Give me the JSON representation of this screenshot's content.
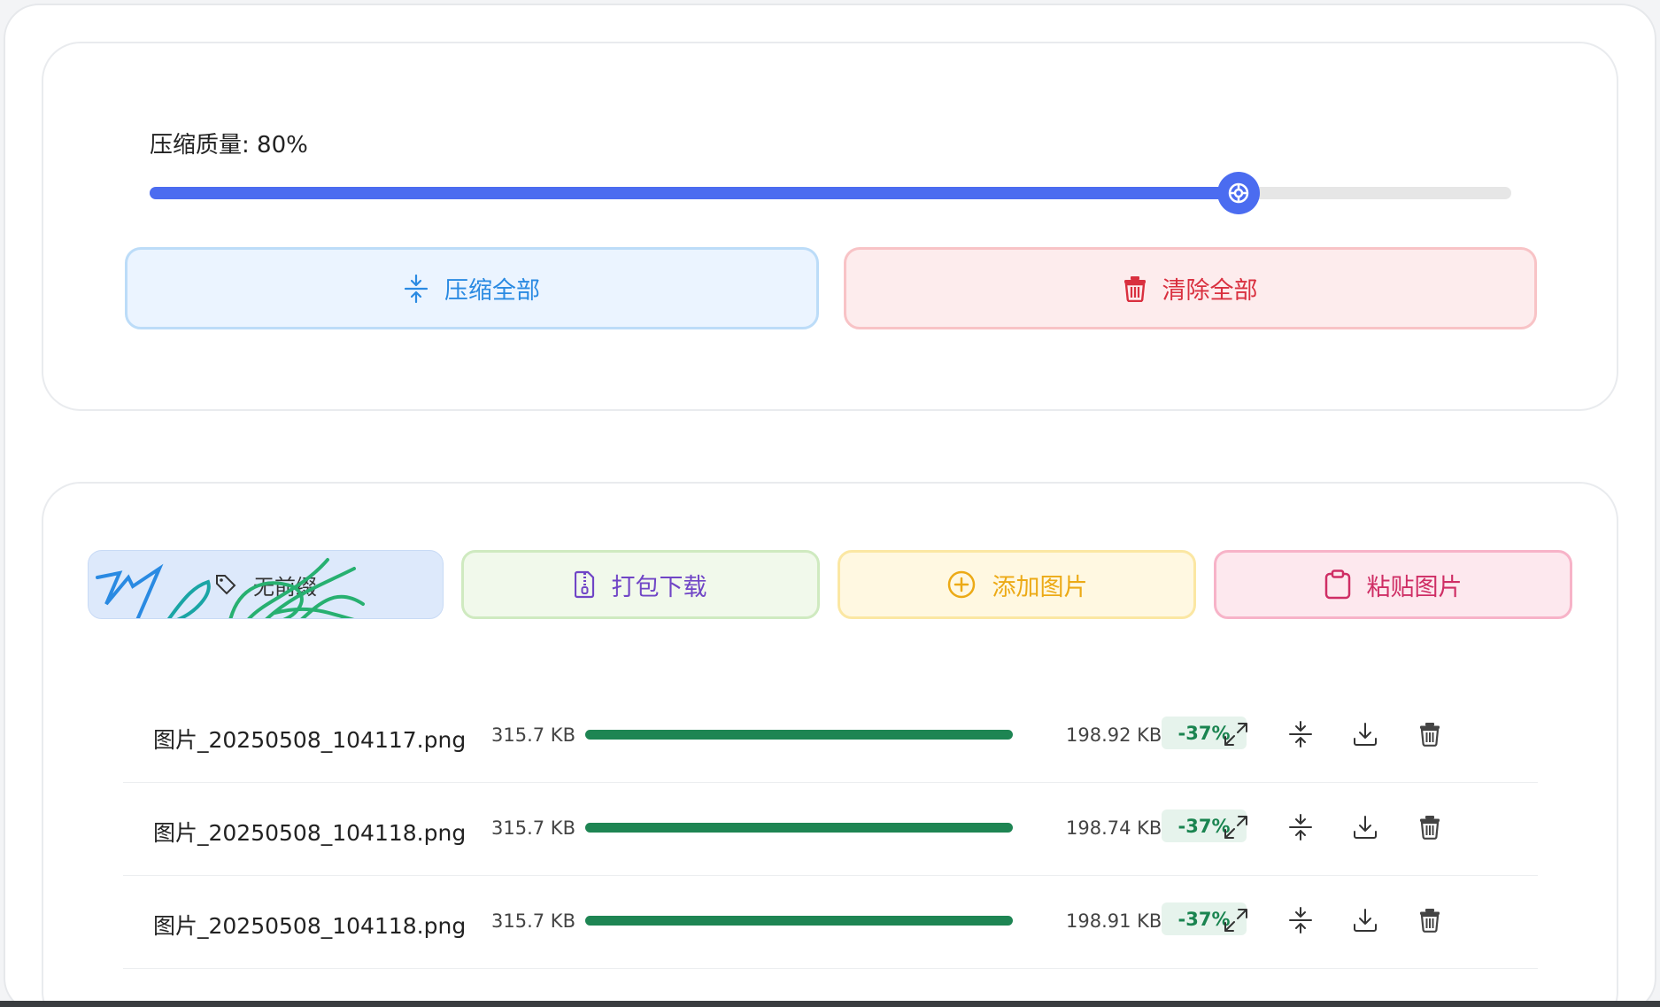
{
  "compression": {
    "label": "压缩质量: 80%",
    "quality_percent": 80
  },
  "actions_top": {
    "compress_all_label": "压缩全部",
    "clear_all_label": "清除全部"
  },
  "actions_bottom": {
    "preview_label": "无前缀",
    "zip_download_label": "打包下载",
    "add_image_label": "添加图片",
    "paste_image_label": "粘贴图片"
  },
  "files": [
    {
      "name": "图片_20250508_104117.png",
      "original_size": "315.7 KB",
      "compressed_size": "198.92 KB",
      "reduction": "-37%",
      "progress": 1.0
    },
    {
      "name": "图片_20250508_104118.png",
      "original_size": "315.7 KB",
      "compressed_size": "198.74 KB",
      "reduction": "-37%",
      "progress": 1.0
    },
    {
      "name": "图片_20250508_104118.png",
      "original_size": "315.7 KB",
      "compressed_size": "198.91 KB",
      "reduction": "-37%",
      "progress": 1.0
    }
  ],
  "icons": {
    "compress": "compress-icon",
    "trash": "trash-icon",
    "zip": "zip-file-icon",
    "add": "plus-circle-icon",
    "paste": "clipboard-icon",
    "expand": "expand-icon",
    "download": "download-icon"
  },
  "colors": {
    "accent": "#4b6cf0",
    "success": "#1e8553",
    "danger": "#d9303f"
  }
}
